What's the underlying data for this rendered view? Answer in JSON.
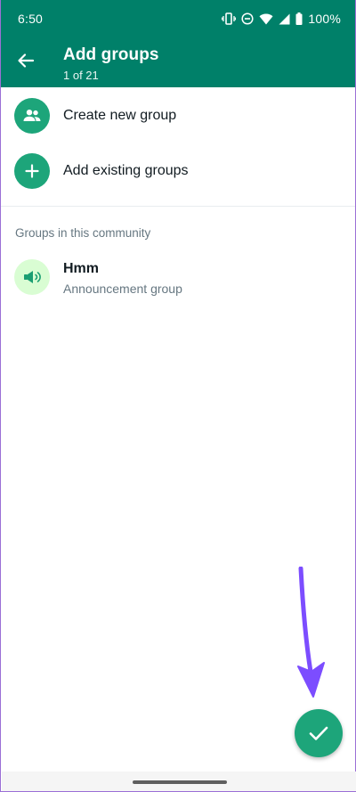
{
  "status_bar": {
    "time": "6:50",
    "battery": "100%",
    "icons": [
      "vibrate-icon",
      "do-not-disturb-icon",
      "wifi-icon",
      "signal-icon",
      "battery-icon"
    ]
  },
  "appbar": {
    "back_icon": "arrow-back-icon",
    "title": "Add groups",
    "subtitle": "1 of 21"
  },
  "actions": [
    {
      "label": "Create new group",
      "icon": "group-icon"
    },
    {
      "label": "Add existing groups",
      "icon": "plus-icon"
    }
  ],
  "section": {
    "title": "Groups in this community"
  },
  "groups": [
    {
      "name": "Hmm",
      "subtitle": "Announcement group",
      "icon": "megaphone-icon"
    }
  ],
  "fab": {
    "icon": "check-icon"
  },
  "colors": {
    "header": "#008069",
    "accent": "#1da57a",
    "announcement_bg": "#d9fdd3",
    "annotation_arrow": "#7c4dff",
    "secondary_text": "#667781"
  }
}
